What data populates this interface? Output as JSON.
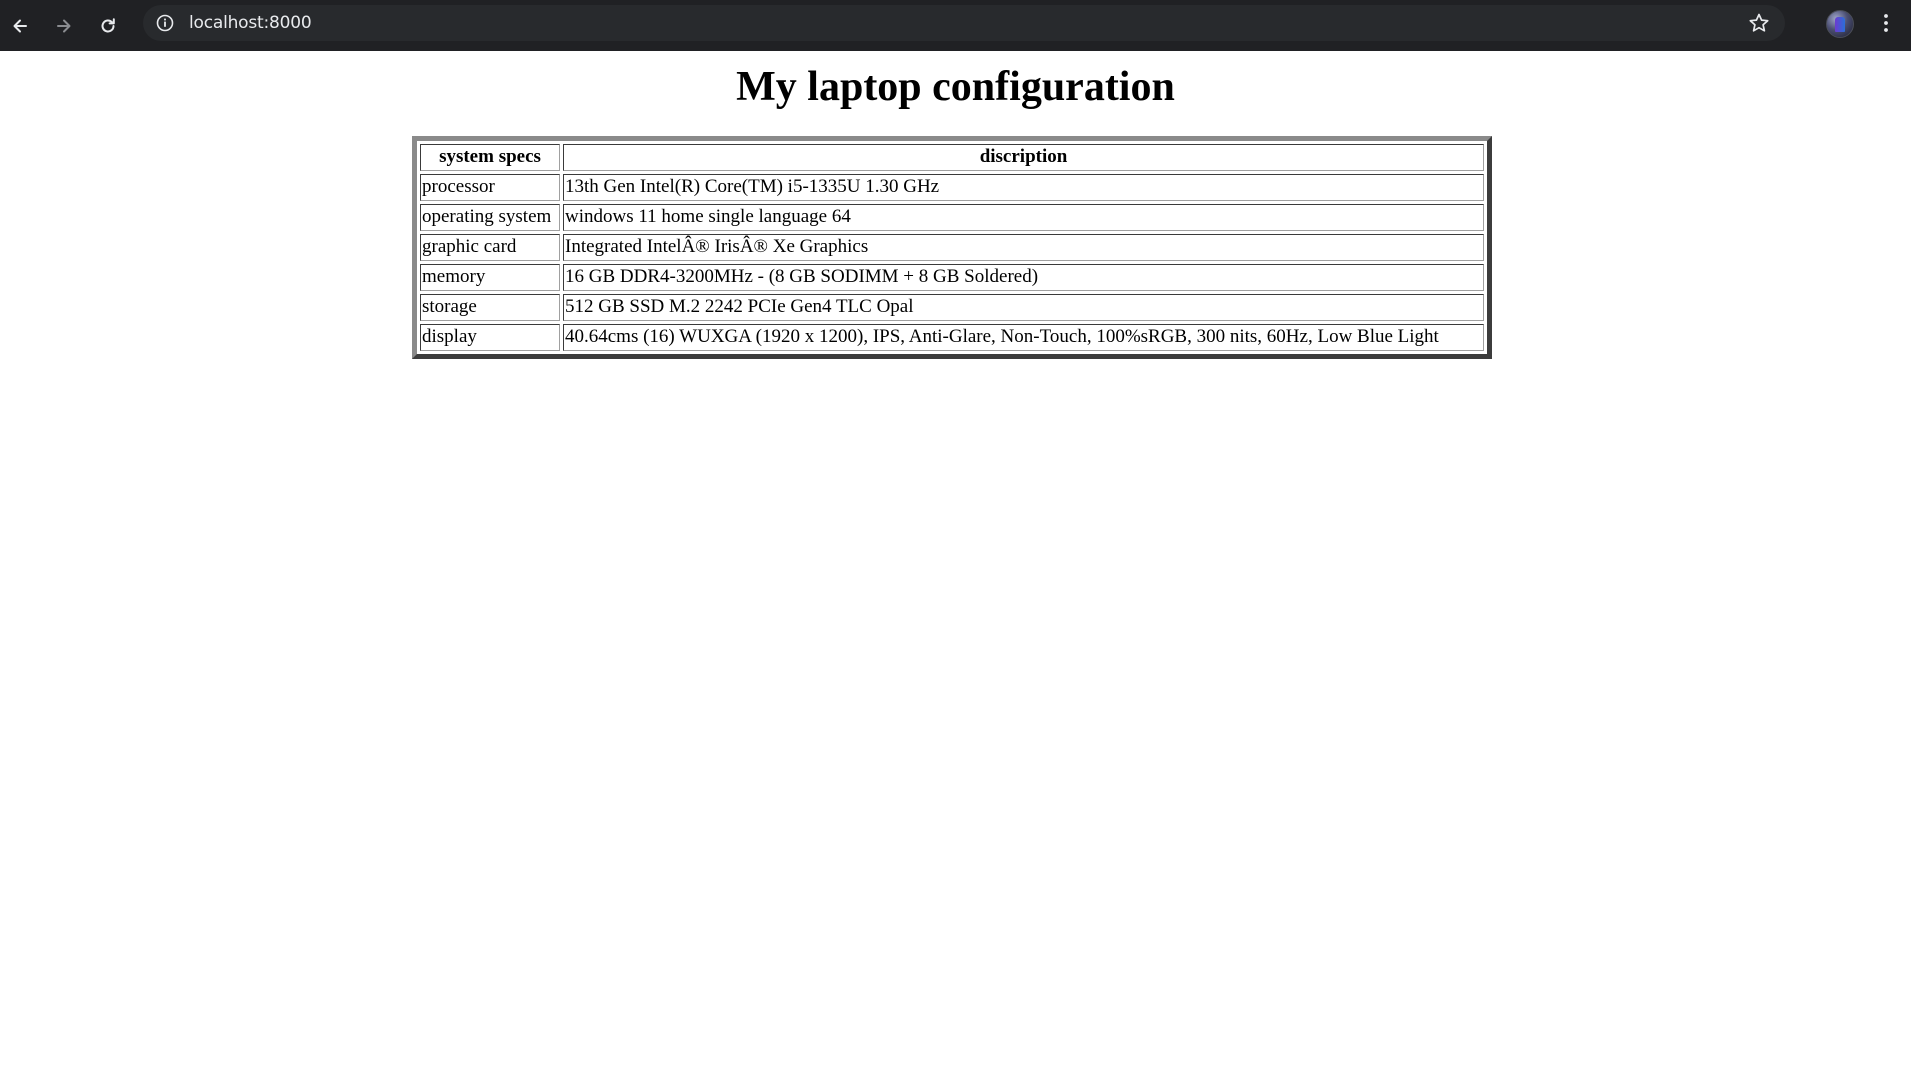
{
  "browser": {
    "url": "localhost:8000",
    "icons": {
      "back": "arrow-left-icon",
      "forward": "arrow-right-icon",
      "reload": "reload-icon",
      "site_info": "info-icon",
      "bookmark": "star-icon",
      "profile": "avatar",
      "menu": "kebab-menu-icon"
    },
    "colors": {
      "toolbar": "#202124",
      "omnibox": "#282a2d",
      "text": "#e8eaed"
    }
  },
  "page": {
    "title": "My laptop configuration",
    "table": {
      "headers": [
        "system specs",
        "discription"
      ],
      "rows": [
        {
          "spec": "processor",
          "description": "13th Gen Intel(R) Core(TM) i5-1335U 1.30 GHz"
        },
        {
          "spec": "operating system",
          "description": "windows 11 home single language 64"
        },
        {
          "spec": "graphic card",
          "description": "Integrated IntelÂ® IrisÂ® Xe Graphics"
        },
        {
          "spec": "memory",
          "description": "16 GB DDR4-3200MHz - (8 GB SODIMM + 8 GB Soldered)"
        },
        {
          "spec": "storage",
          "description": "512 GB SSD M.2 2242 PCIe Gen4 TLC Opal"
        },
        {
          "spec": "display",
          "description": "40.64cms (16) WUXGA (1920 x 1200), IPS, Anti-Glare, Non-Touch, 100%sRGB, 300 nits, 60Hz, Low Blue Light"
        }
      ]
    }
  }
}
